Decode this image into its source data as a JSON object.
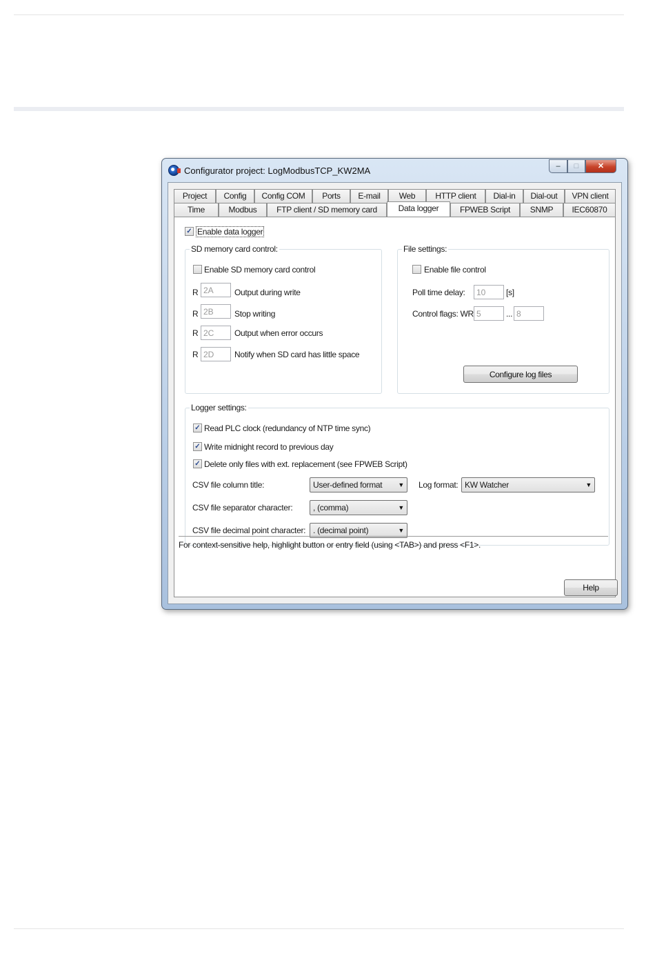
{
  "window": {
    "title": "Configurator project: LogModbusTCP_KW2MA",
    "min_glyph": "–",
    "max_glyph": "□",
    "close_glyph": "✕"
  },
  "tabs_row1": [
    "Project",
    "Config",
    "Config COM",
    "Ports",
    "E-mail",
    "Web",
    "HTTP client",
    "Dial-in",
    "Dial-out",
    "VPN client"
  ],
  "tabs_row2": [
    "Time",
    "Modbus",
    "FTP client / SD memory card",
    "Data logger",
    "FPWEB Script",
    "SNMP",
    "IEC60870"
  ],
  "enable_data_logger": {
    "label": "Enable data logger",
    "checked": true
  },
  "sd_group": {
    "title": "SD memory card control:",
    "enable": {
      "label": "Enable SD memory card control",
      "checked": false
    },
    "rows": [
      {
        "prefix": "R",
        "value": "2A",
        "label": "Output during write"
      },
      {
        "prefix": "R",
        "value": "2B",
        "label": "Stop writing"
      },
      {
        "prefix": "R",
        "value": "2C",
        "label": "Output when error occurs"
      },
      {
        "prefix": "R",
        "value": "2D",
        "label": "Notify when SD card has little space"
      }
    ]
  },
  "file_group": {
    "title": "File settings:",
    "enable": {
      "label": "Enable file control",
      "checked": false
    },
    "poll_label": "Poll time delay:",
    "poll_value": "10",
    "poll_unit": "[s]",
    "flags_label": "Control flags: WR",
    "flags_from": "5",
    "flags_sep": "...",
    "flags_to": "8",
    "configure_button": "Configure log files"
  },
  "logger_group": {
    "title": "Logger settings:",
    "options": [
      {
        "label": "Read PLC clock (redundancy of NTP time sync)",
        "checked": true
      },
      {
        "label": "Write midnight record to previous day",
        "checked": true
      },
      {
        "label": "Delete only files with ext. replacement (see FPWEB Script)",
        "checked": true
      }
    ],
    "csv_column_label": "CSV file column title:",
    "csv_column_value": "User-defined format",
    "log_format_label": "Log format:",
    "log_format_value": "KW Watcher",
    "csv_separator_label": "CSV file separator character:",
    "csv_separator_value": ", (comma)",
    "csv_decimal_label": "CSV file decimal point character:",
    "csv_decimal_value": ". (decimal point)"
  },
  "help_text": "For context-sensitive help, highlight button or entry field (using <TAB>) and press <F1>.",
  "help_button": "Help",
  "check_glyph": "✓",
  "dropdown_glyph": "▼"
}
